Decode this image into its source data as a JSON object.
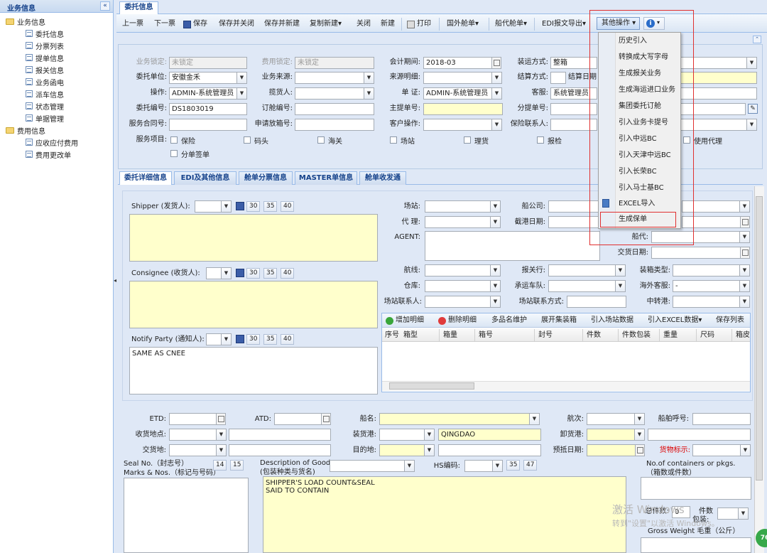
{
  "sidebar": {
    "title": "业务信息",
    "collapse": "«",
    "groups": [
      {
        "label": "业务信息",
        "items": [
          "委托信息",
          "分票列表",
          "提单信息",
          "报关信息",
          "业务函电",
          "派车信息",
          "状态管理",
          "单据管理"
        ]
      },
      {
        "label": "费用信息",
        "items": [
          "应收应付费用",
          "费用更改单"
        ]
      }
    ]
  },
  "tab": {
    "label": "委托信息"
  },
  "toolbar": {
    "prev": "上一票",
    "next": "下一票",
    "save": "保存",
    "save_close": "保存并关闭",
    "save_new": "保存并新建",
    "copy_new": "复制新建",
    "close": "关闭",
    "new": "新建",
    "print": "打印",
    "foreign_bill": "国外舱单",
    "agent_bill": "船代舱单",
    "edi_export": "EDI报文导出",
    "other_ops": "其他操作"
  },
  "menu": {
    "items": [
      "历史引入",
      "转换成大写字母",
      "生成报关业务",
      "生成海运进口业务",
      "集团委托订舱",
      "引入业务卡提号",
      "引入中远BC",
      "引入天津中远BC",
      "引入长荣BC",
      "引入马士基BC",
      "EXCEL导入",
      "生成保单"
    ]
  },
  "form": {
    "biz_lock_label": "业务锁定:",
    "biz_lock_val": "未锁定",
    "fee_lock_label": "费用锁定:",
    "fee_lock_val": "未锁定",
    "period_label": "会计期间:",
    "period_val": "2018-03",
    "transport_label": "装运方式:",
    "transport_val": "整箱",
    "client_label": "委托单位:",
    "client_val": "安徽金禾",
    "source_label": "业务来源:",
    "source_detail_label": "来源明细:",
    "settle_label": "结算方式:",
    "settle_date_label": "结算日期",
    "op_label": "操作:",
    "op_val": "ADMIN-系统管理员",
    "pickup_label": "揽货人:",
    "voucher_label": "单 证:",
    "voucher_val": "ADMIN-系统管理员",
    "cs_label": "客服:",
    "cs_val": "系统管理员",
    "order_no_label": "委托编号:",
    "order_no_val": "DS1803019",
    "booking_no_label": "订舱编号:",
    "mbl_label": "主提单号:",
    "hbl_label": "分提单号:",
    "contract_label": "服务合同号:",
    "release_label": "申请放箱号:",
    "cust_op_label": "客户操作:",
    "ins_contact_label": "保险联系人:",
    "service_label": "服务项目:",
    "services": [
      "保险",
      "码头",
      "海关",
      "场站",
      "理货",
      "报检",
      "使用代理",
      "分单签单"
    ]
  },
  "subtabs": [
    "委托详细信息",
    "EDI及其他信息",
    "舱单分票信息",
    "MASTER单信息",
    "舱单收发通"
  ],
  "detail": {
    "shipper_label": "Shipper (发货人):",
    "consignee_label": "Consignee (收货人):",
    "notify_label": "Notify Party (通知人):",
    "notify_val": "SAME AS CNEE",
    "n30": "30",
    "n35": "35",
    "n40": "40",
    "yard_label": "场站:",
    "carrier_label": "船公司:",
    "agent_label": "代 理:",
    "cutoff_label": "截港日期:",
    "agent2_label": "AGENT:",
    "shipagent_label": "船代:",
    "delivery_label": "交货日期:",
    "route_label": "航线:",
    "broker_label": "报关行:",
    "packtype_label": "装箱类型:",
    "warehouse_label": "仓库:",
    "truck_label": "承运车队:",
    "overseas_label": "海外客服:",
    "overseas_val": "-",
    "yard_contact_label": "场站联系人:",
    "yard_contact_way_label": "场站联系方式:",
    "transit_label": "中转港:"
  },
  "grid": {
    "toolbar": [
      "增加明细",
      "删除明细",
      "多品名维护",
      "展开集装箱",
      "引入场站数据",
      "引入EXCEL数据",
      "保存列表"
    ],
    "columns": [
      "序号",
      "箱型",
      "箱量",
      "箱号",
      "封号",
      "件数",
      "件数包装",
      "重量",
      "尺码",
      "箱皮"
    ]
  },
  "bottom": {
    "etd_label": "ETD:",
    "atd_label": "ATD:",
    "vessel_label": "船名:",
    "voyage_label": "航次:",
    "callsign_label": "船舶呼号:",
    "receipt_label": "收货地点:",
    "pol_label": "装货港:",
    "pol_val": "QINGDAO",
    "pod_label": "卸货港:",
    "delivery_place_label": "交货地:",
    "dest_label": "目的地:",
    "eta_label": "预抵日期:",
    "mark_label": "货物标示:",
    "seal_label": "Seal No.（封志号）",
    "marks_label": "Marks & Nos.（标记与号码）",
    "n14": "14",
    "n15": "15",
    "desc_label": "Description of Goods",
    "desc_sub": "(包装种类与货名)",
    "hs_label": "HS编码:",
    "n47": "47",
    "desc_val": "SHIPPER'S LOAD COUNT&SEAL\nSAID TO CONTAIN",
    "pkgs_label": "No.of containers or pkgs.",
    "pkgs_sub": "（箱数或件数）",
    "total_label": "总件数:",
    "total_val": "0",
    "pieces_label": "件数",
    "pack_label": "包装:",
    "gw_label": "Gross Weight 毛重（公斤）"
  },
  "watermark": {
    "line1": "激活 Windows",
    "line2": "转到\"设置\"以激活 Windows。"
  },
  "badge": "76"
}
